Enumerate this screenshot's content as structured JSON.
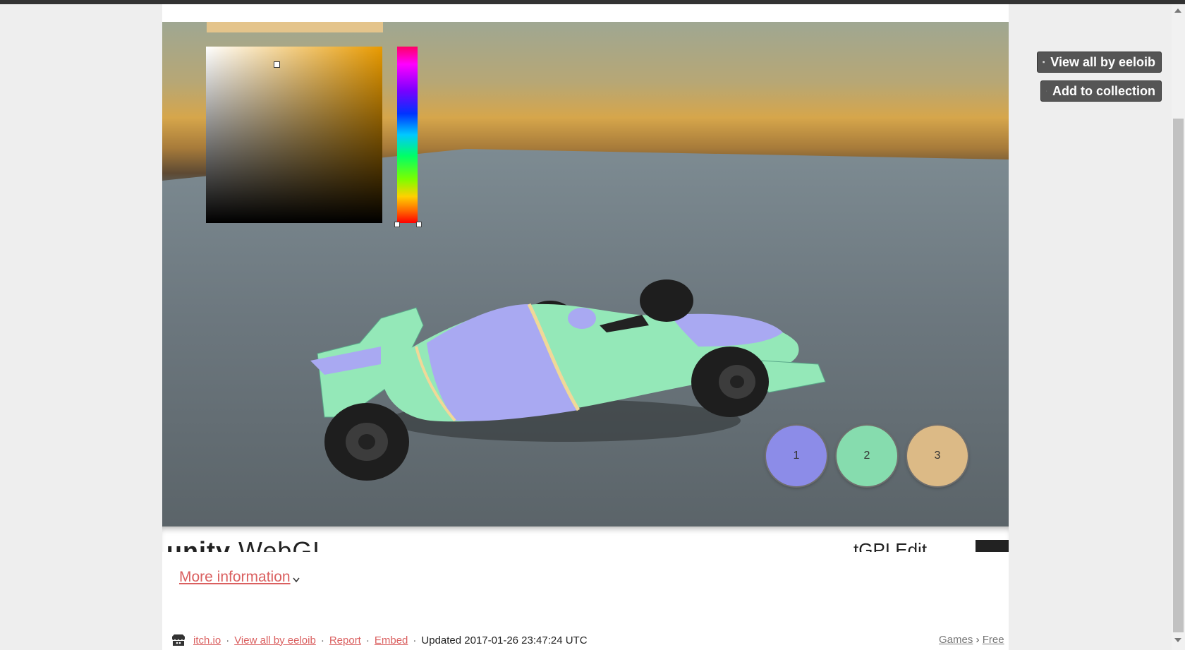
{
  "game": {
    "palette_buttons": [
      {
        "label": "1",
        "color": "#8c8ce8"
      },
      {
        "label": "2",
        "color": "#86dcae"
      },
      {
        "label": "3",
        "color": "#dcba86"
      }
    ],
    "color_picker": {
      "base_hue": "#e89a00"
    },
    "car_colors": {
      "primary": "#a9a9f2",
      "secondary": "#94e8b8",
      "stripe": "#f0d898"
    }
  },
  "unity_footer": {
    "logo_light": "unity",
    "logo_text": "WebGL",
    "right_text": "tGPI    Edit"
  },
  "side_actions": {
    "view_all": "View all by eeloib",
    "add_collection": "Add to collection"
  },
  "more_info": {
    "label": "More information"
  },
  "footer": {
    "site": "itch.io",
    "view_all": "View all by eeloib",
    "report": "Report",
    "embed": "Embed",
    "updated": "Updated 2017-01-26 23:47:24 UTC",
    "crumb_games": "Games",
    "crumb_sep": "›",
    "crumb_free": "Free"
  },
  "colors": {
    "link": "#da5f5f",
    "button_bg": "#555555",
    "topbar": "#333333"
  }
}
